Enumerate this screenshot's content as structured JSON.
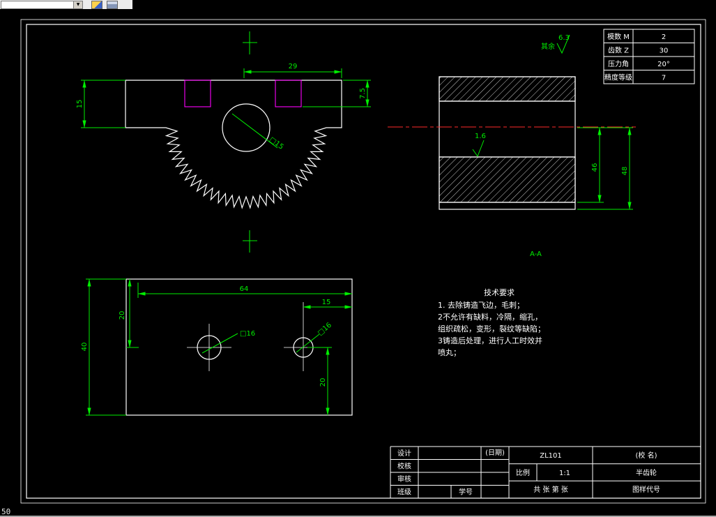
{
  "toolbar": {
    "combo_value": ""
  },
  "status_text": "50",
  "param_table": {
    "rows": [
      {
        "label": "模数 M",
        "value": "2"
      },
      {
        "label": "齿数 Z",
        "value": "30"
      },
      {
        "label": "压力角",
        "value": "20°"
      },
      {
        "label": "精度等级",
        "value": "7"
      }
    ]
  },
  "roughness": {
    "rest_label": "其余",
    "rest_value": "6.3",
    "bore_value": "1.6"
  },
  "section_label": "A-A",
  "dims": {
    "front_width": "29",
    "front_height": "15",
    "keyway_depth": "7.5",
    "front_bore": "□15",
    "side_inner": "46",
    "side_outer": "48",
    "bottom_width": "64",
    "bottom_offset": "15",
    "bottom_height": "40",
    "bottom_top_offset": "20",
    "bottom_bottom_offset": "20",
    "bore_left": "□16",
    "bore_right": "□16"
  },
  "tech": {
    "title": "技术要求",
    "lines": [
      "1. 去除铸造飞边，毛刺；",
      "2不允许有缺料，冷隔，缩孔，",
      "组织疏松，变形，裂纹等缺陷；",
      "3铸造后处理，进行人工时效并",
      "喷丸；"
    ]
  },
  "title_block": {
    "design": "设计",
    "check": "校核",
    "review": "审核",
    "class": "班级",
    "date": "(日期)",
    "student_id": "学号",
    "drawing_no": "ZL101",
    "school": "(校 名)",
    "scale_label": "比例",
    "scale": "1:1",
    "part_name": "半齿轮",
    "sheet_info": "共 张 第 张",
    "code_label": "图样代号"
  },
  "colors": {
    "dim": "#00ee00",
    "outline": "#ffffff",
    "keyway": "#ff00ff",
    "centerline": "#ff2a2a"
  }
}
